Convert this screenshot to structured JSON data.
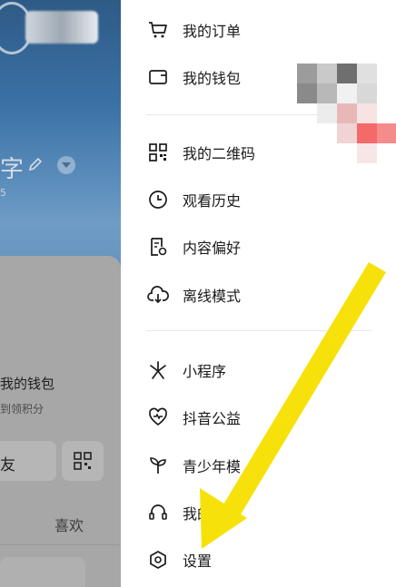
{
  "profile": {
    "name_fragment": "字",
    "sub_fragment": "5",
    "wallet_title": "我的钱包",
    "wallet_sub": "到领积分",
    "friend_button": "友",
    "tab_like": "喜欢"
  },
  "menu": {
    "group1": [
      {
        "label": "我的订单",
        "icon": "cart-icon"
      },
      {
        "label": "我的钱包",
        "icon": "wallet-icon"
      }
    ],
    "group2": [
      {
        "label": "我的二维码",
        "icon": "qr-code-icon"
      },
      {
        "label": "观看历史",
        "icon": "clock-icon"
      },
      {
        "label": "内容偏好",
        "icon": "document-settings-icon"
      },
      {
        "label": "离线模式",
        "icon": "cloud-download-icon"
      }
    ],
    "group3": [
      {
        "label": "小程序",
        "icon": "asterisk-icon"
      },
      {
        "label": "抖音公益",
        "icon": "heart-icon"
      },
      {
        "label": "青少年模",
        "icon": "sprout-icon"
      },
      {
        "label": "我的",
        "icon": "headset-icon"
      },
      {
        "label": "设置",
        "icon": "hexagon-settings-icon"
      }
    ]
  },
  "colors": {
    "arrow": "#f7e10a",
    "text": "#1a1a1a",
    "divider": "#e8e8e8"
  }
}
